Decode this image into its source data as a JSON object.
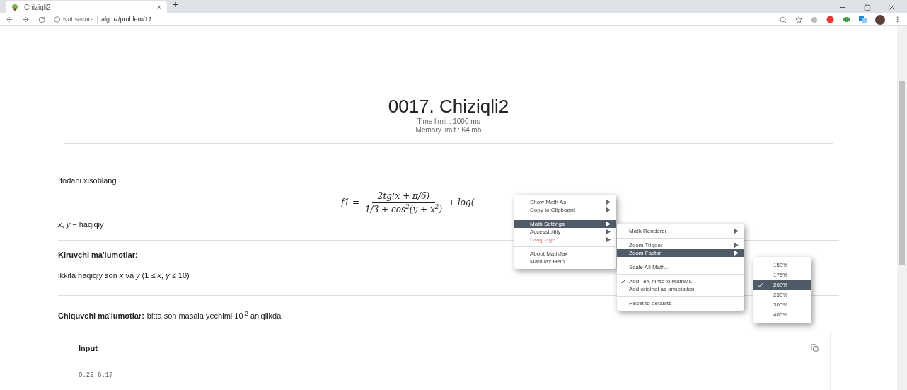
{
  "browser": {
    "tab_title": "Chiziqli2",
    "tab_close": "×",
    "new_tab": "+",
    "security": "Not secure",
    "divider": "|",
    "url": "alg.uz/problem/17"
  },
  "problem": {
    "title": "0017. Chiziqli2",
    "time_limit": "Time limit : 1000 ms",
    "memory_limit": "Memory limit : 64 mb"
  },
  "statement": "Ifodani xisoblang",
  "formula": {
    "lhs": "f1 =",
    "numerator": "2tg(x + π/6)",
    "denominator": "1/3 + cos$^{2}$(y + x$^{2}$)",
    "tail": "+ log("
  },
  "variables": "*x*, *y* − haqiqiy",
  "input_section": {
    "heading": "Kiruvchi ma'lumotlar:",
    "text": "ikkita haqiqiy son *x* va *y* (1 ≤ *x*, *y* ≤ 10)"
  },
  "output_section": {
    "heading": "Chiquvchi ma'lumotlar:",
    "text": "bitta son masala yechimi 10$^{-2}$ aniqlikda"
  },
  "example": {
    "label": "Input",
    "value": "0.22 6.17"
  },
  "context_menu": [
    {
      "kind": "item",
      "label": "Show Math As",
      "submenu": true,
      "selected": false,
      "disabled": false
    },
    {
      "kind": "item",
      "label": "Copy to Clipboard",
      "submenu": true,
      "selected": false,
      "disabled": false
    },
    {
      "kind": "separator"
    },
    {
      "kind": "item",
      "label": "Math Settings",
      "submenu": true,
      "selected": true,
      "disabled": false
    },
    {
      "kind": "item",
      "label": "Accessibility",
      "submenu": true,
      "selected": false,
      "disabled": false
    },
    {
      "kind": "item",
      "label": "Language",
      "submenu": true,
      "selected": false,
      "disabled": true
    },
    {
      "kind": "separator"
    },
    {
      "kind": "item",
      "label": "About MathJax",
      "submenu": false,
      "selected": false,
      "disabled": false
    },
    {
      "kind": "item",
      "label": "MathJax Help",
      "submenu": false,
      "selected": false,
      "disabled": false
    }
  ],
  "settings_menu": [
    {
      "kind": "item",
      "label": "Math Renderer",
      "submenu": true,
      "selected": false,
      "checked": false
    },
    {
      "kind": "separator"
    },
    {
      "kind": "item",
      "label": "Zoom Trigger",
      "submenu": true,
      "selected": false,
      "checked": false
    },
    {
      "kind": "item",
      "label": "Zoom Factor",
      "submenu": true,
      "selected": true,
      "checked": false
    },
    {
      "kind": "separator"
    },
    {
      "kind": "item",
      "label": "Scale All Math...",
      "submenu": false,
      "selected": false,
      "checked": false
    },
    {
      "kind": "separator"
    },
    {
      "kind": "item",
      "label": "Add TeX hints to MathML",
      "submenu": false,
      "selected": false,
      "checked": true
    },
    {
      "kind": "item",
      "label": "Add original as annotation",
      "submenu": false,
      "selected": false,
      "checked": false
    },
    {
      "kind": "separator"
    },
    {
      "kind": "item",
      "label": "Reset to defaults",
      "submenu": false,
      "selected": false,
      "checked": false
    }
  ],
  "zoom_menu": [
    {
      "label": "150%",
      "selected": false
    },
    {
      "label": "175%",
      "selected": false
    },
    {
      "label": "200%",
      "selected": true
    },
    {
      "label": "250%",
      "selected": false
    },
    {
      "label": "300%",
      "selected": false
    },
    {
      "label": "400%",
      "selected": false
    }
  ]
}
